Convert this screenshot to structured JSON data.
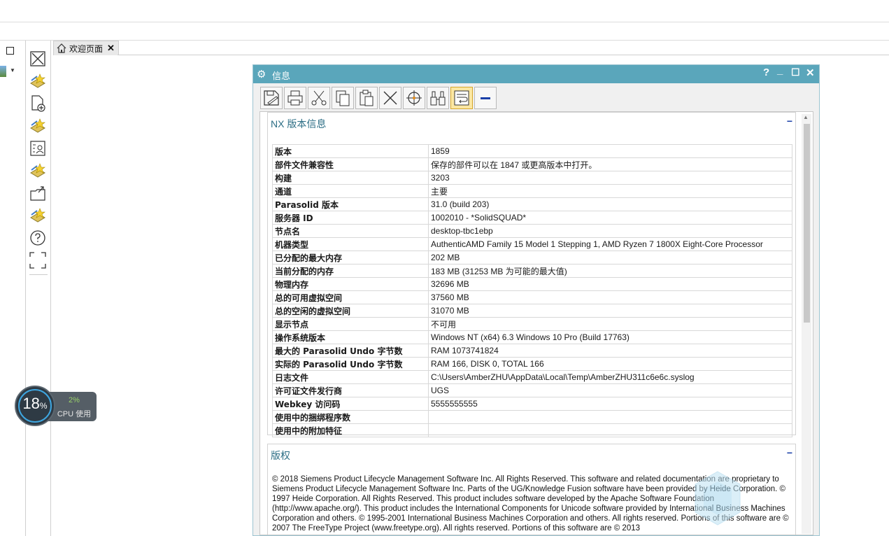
{
  "tab": {
    "label": "欢迎页面",
    "close": "✕"
  },
  "cpu": {
    "value": "18",
    "unit": "%",
    "load": "2%",
    "label": "CPU 使用"
  },
  "dialog": {
    "title": "信息",
    "help": "?",
    "minimize": "_",
    "maximize": "☐",
    "close": "✕",
    "toolbar": [
      "save-icon",
      "print-icon",
      "cut-icon",
      "copy-icon",
      "paste-icon",
      "delete-icon",
      "target-icon",
      "find-icon",
      "wrap-icon",
      "minus-icon"
    ]
  },
  "version_section": {
    "title": "NX 版本信息",
    "collapse": "−",
    "rows": [
      {
        "key": "版本",
        "value": "1859"
      },
      {
        "key": "部件文件兼容性",
        "value": "保存的部件可以在 1847 或更高版本中打开。"
      },
      {
        "key": "构建",
        "value": "3203"
      },
      {
        "key": "通道",
        "value": "主要"
      },
      {
        "key": "Parasolid 版本",
        "value": "31.0 (build 203)"
      },
      {
        "key": "服务器 ID",
        "value": "1002010 - *SolidSQUAD*"
      },
      {
        "key": "节点名",
        "value": "desktop-tbc1ebp"
      },
      {
        "key": "机器类型",
        "value": "AuthenticAMD Family 15 Model 1 Stepping 1, AMD Ryzen 7 1800X Eight-Core Processor"
      },
      {
        "key": "已分配的最大内存",
        "value": "202 MB"
      },
      {
        "key": "当前分配的内存",
        "value": "183 MB (31253 MB 为可能的最大值)"
      },
      {
        "key": "物理内存",
        "value": "32696 MB"
      },
      {
        "key": "总的可用虚拟空间",
        "value": "37560 MB"
      },
      {
        "key": "总的空闲的虚拟空间",
        "value": "31070 MB"
      },
      {
        "key": "显示节点",
        "value": "不可用"
      },
      {
        "key": "操作系统版本",
        "value": "Windows NT (x64) 6.3 Windows 10 Pro (Build 17763)"
      },
      {
        "key": "最大的 Parasolid Undo 字节数",
        "value": "RAM 1073741824"
      },
      {
        "key": "实际的 Parasolid Undo 字节数",
        "value": "RAM 166, DISK 0, TOTAL 166"
      },
      {
        "key": "日志文件",
        "value": "C:\\Users\\AmberZHU\\AppData\\Local\\Temp\\AmberZHU311c6e6c.syslog"
      },
      {
        "key": "许可证文件发行商",
        "value": "UGS"
      },
      {
        "key": "Webkey 访问码",
        "value": "5555555555"
      },
      {
        "key": "使用中的捆绑程序数",
        "value": ""
      },
      {
        "key": "使用中的附加特征",
        "value": ""
      }
    ]
  },
  "copyright_section": {
    "title": "版权",
    "collapse": "−",
    "text": "© 2018 Siemens Product Lifecycle Management Software Inc. All Rights Reserved. This software and related documentation are proprietary to Siemens Product Lifecycle Management Software Inc. Parts of the UG/Knowledge Fusion software have been provided by Heide Corporation. © 1997 Heide Corporation. All Rights Reserved. This product includes software developed by the Apache Software Foundation (http://www.apache.org/). This product includes the International Components for Unicode software provided by International Business Machines Corporation and others. © 1995-2001 International Business Machines Corporation and others. All rights reserved. Portions of this software are © 2007 The FreeType Project (www.freetype.org). All rights reserved. Portions of this software are © 2013"
  },
  "colors": {
    "title_bar": "#5aa6bb",
    "section_title": "#2c6e85",
    "collapse": "#1a3fa8"
  }
}
